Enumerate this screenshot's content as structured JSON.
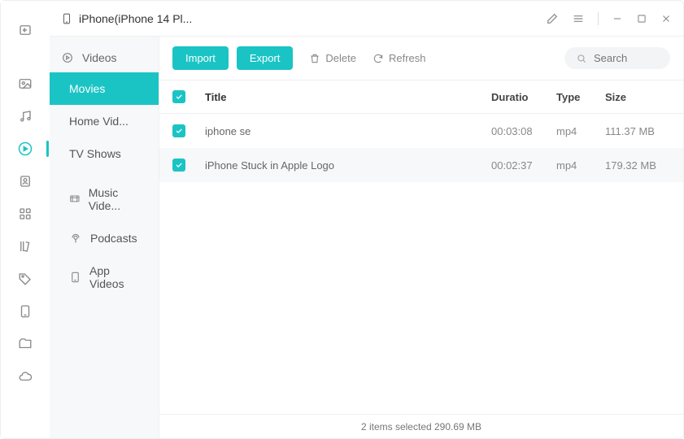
{
  "device_name": "iPhone(iPhone 14 Pl...",
  "rail": [
    {
      "name": "back",
      "active": false
    },
    {
      "name": "photos",
      "active": false
    },
    {
      "name": "music",
      "active": false
    },
    {
      "name": "videos",
      "active": true
    },
    {
      "name": "contacts",
      "active": false
    },
    {
      "name": "apps",
      "active": false
    },
    {
      "name": "books",
      "active": false
    },
    {
      "name": "tags",
      "active": false
    },
    {
      "name": "storage",
      "active": false
    },
    {
      "name": "files",
      "active": false
    },
    {
      "name": "cloud",
      "active": false
    }
  ],
  "sidebar": {
    "head": "Videos",
    "items": [
      {
        "label": "Movies",
        "active": true,
        "icon": null
      },
      {
        "label": "Home Vid...",
        "active": false,
        "icon": null
      },
      {
        "label": "TV Shows",
        "active": false,
        "icon": null
      },
      {
        "label": "Music Vide...",
        "active": false,
        "icon": "music"
      },
      {
        "label": "Podcasts",
        "active": false,
        "icon": "podcast"
      },
      {
        "label": "App Videos",
        "active": false,
        "icon": "app"
      }
    ]
  },
  "toolbar": {
    "import": "Import",
    "export": "Export",
    "delete": "Delete",
    "refresh": "Refresh",
    "search_placeholder": "Search"
  },
  "columns": {
    "title": "Title",
    "duration": "Duratio",
    "type": "Type",
    "size": "Size"
  },
  "rows": [
    {
      "checked": true,
      "title": "iphone se",
      "duration": "00:03:08",
      "type": "mp4",
      "size": "111.37 MB"
    },
    {
      "checked": true,
      "title": "iPhone Stuck in Apple Logo",
      "duration": "00:02:37",
      "type": "mp4",
      "size": "179.32 MB"
    }
  ],
  "status": "2 items selected 290.69 MB"
}
